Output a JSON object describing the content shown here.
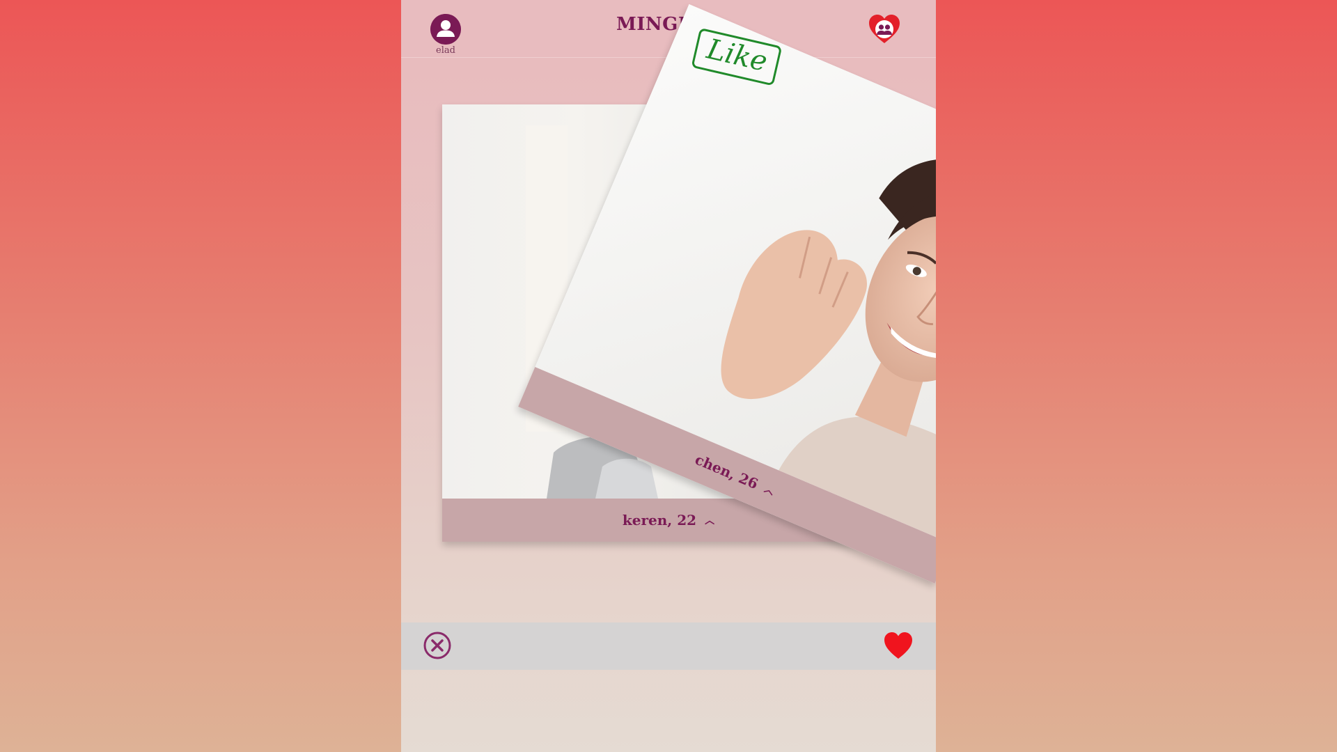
{
  "header": {
    "title": "MINGLER",
    "profile": {
      "username": "elad",
      "icon": "user-avatar-icon"
    },
    "matches_icon": "heart-couple-icon"
  },
  "cards": [
    {
      "name_age": "keren, 22",
      "expand_icon": "chevron-up-icon"
    },
    {
      "name_age": "chen, 26",
      "expand_icon": "chevron-up-icon",
      "stamp": "Like"
    }
  ],
  "actions": {
    "dislike_icon": "close-circle-icon",
    "like_icon": "heart-icon"
  },
  "colors": {
    "brand": "#7a1a55",
    "like_green": "#208a2a",
    "heart_red": "#f0141e",
    "caption_bg": "#c7a6a8",
    "action_bar": "#d5d3d3"
  }
}
